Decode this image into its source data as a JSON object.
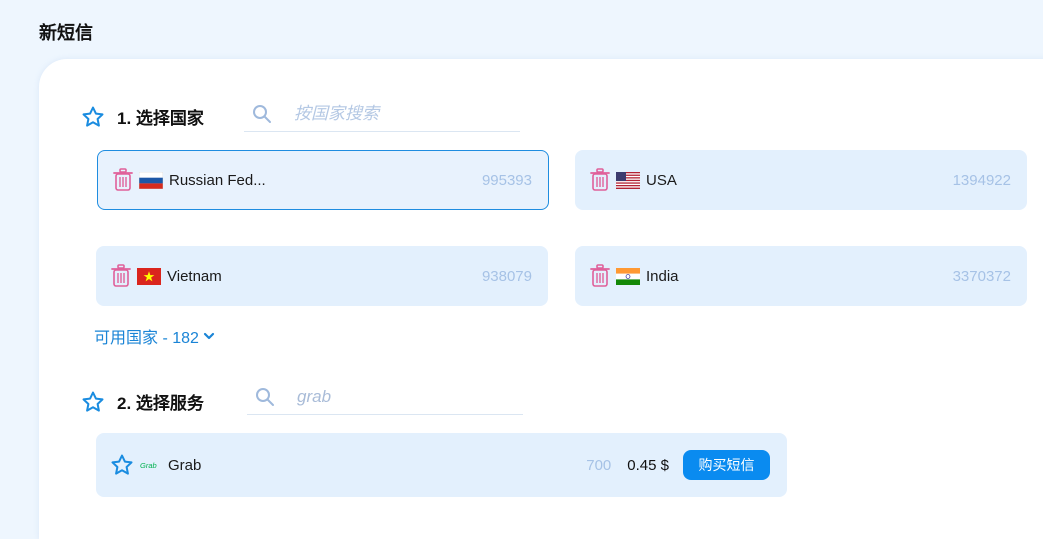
{
  "header": {
    "title": "新短信"
  },
  "step1": {
    "title": "1. 选择国家",
    "search_placeholder": "按国家搜索",
    "countries": [
      {
        "name": "Russian Fed...",
        "count": "995393",
        "flag": "russia-flag"
      },
      {
        "name": "USA",
        "count": "1394922",
        "flag": "usa-flag"
      },
      {
        "name": "Vietnam",
        "count": "938079",
        "flag": "vietnam-flag"
      },
      {
        "name": "India",
        "count": "3370372",
        "flag": "india-flag"
      }
    ],
    "available_label": "可用国家 - 182"
  },
  "step2": {
    "title": "2. 选择服务",
    "search_value": "grab",
    "services": [
      {
        "name": "Grab",
        "logo_text": "Grab",
        "count": "700",
        "price": "0.45 $",
        "buy_label": "购买短信"
      }
    ]
  },
  "colors": {
    "accent": "#0a8bf0",
    "card_bg": "#e3f0fd",
    "trash": "#e0609a",
    "count": "#a6c2e6"
  }
}
